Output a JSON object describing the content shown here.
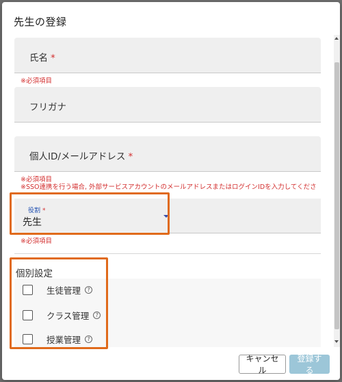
{
  "dialog": {
    "title": "先生の登録"
  },
  "fields": {
    "name": {
      "label": "氏名",
      "required_mark": "*",
      "help": "※必須項目"
    },
    "furigana": {
      "label": "フリガナ"
    },
    "email": {
      "label": "個人ID/メールアドレス",
      "required_mark": "*",
      "help_lines": [
        "※必須項目",
        "※SSO連携を行う場合, 外部サービスアカウントのメールアドレスまたはログインIDを入力してくださ"
      ]
    },
    "role": {
      "label": "役割",
      "required_mark": "*",
      "value": "先生",
      "help": "※必須項目"
    }
  },
  "individual_settings": {
    "title": "個別設定",
    "items": [
      {
        "label": "生徒管理",
        "checked": false,
        "icon": "help-circle-icon"
      },
      {
        "label": "クラス管理",
        "checked": false,
        "icon": "help-circle-icon"
      },
      {
        "label": "授業管理",
        "checked": false,
        "icon": "help-circle-icon"
      }
    ]
  },
  "footer": {
    "cancel_label": "キャンセル",
    "submit_label": "登録する"
  },
  "colors": {
    "required": "#d32f2f",
    "highlight": "#e06a1b",
    "submit_disabled": "#9cc6d8",
    "select_label": "#1f4fb0"
  }
}
